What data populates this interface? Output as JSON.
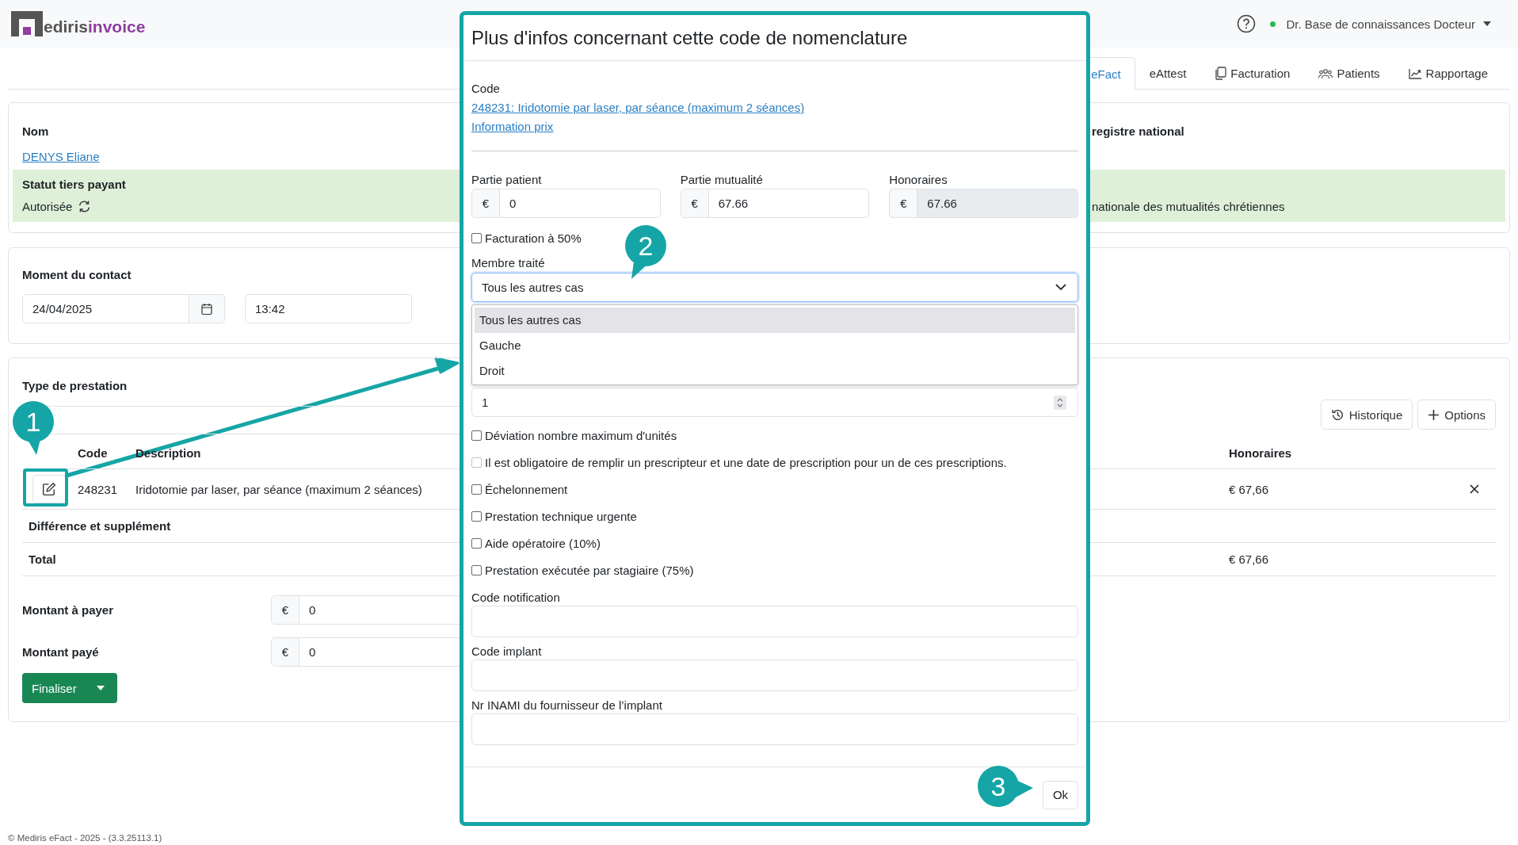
{
  "header": {
    "logo_parts": [
      "ediris",
      "invoice"
    ],
    "online": true,
    "user": "Dr. Base de connaissances Docteur"
  },
  "tabs": [
    {
      "label": "eFact",
      "selected": true
    },
    {
      "label": "eAttest",
      "selected": false
    },
    {
      "label": "Facturation",
      "selected": false
    },
    {
      "label": "Patients",
      "selected": false
    },
    {
      "label": "Rapportage",
      "selected": false
    }
  ],
  "patient_card": {
    "name_label": "Nom",
    "name": "DENYS Eliane",
    "status_label": "Statut tiers payant",
    "status": "Autorisée",
    "column_2_label": "registre national",
    "column_2_value": "nationale des mutualités chrétiennes"
  },
  "contact": {
    "title": "Moment du contact",
    "date": "24/04/2025",
    "time": "13:42"
  },
  "services": {
    "title": "Type de prestation",
    "buttons": [
      "Historique",
      "Options"
    ],
    "columns": [
      "Code",
      "Description",
      "Honoraires"
    ],
    "rows": [
      {
        "code": "248231",
        "description": "Iridotomie par laser, par séance (maximum 2 séances)",
        "fee": "€ 67,66"
      }
    ],
    "difference_label": "Différence et supplément",
    "total_label": "Total",
    "total": "€ 67,66",
    "amounts": [
      {
        "label": "Montant à payer",
        "currency": "€",
        "value": "0"
      },
      {
        "label": "Montant payé",
        "currency": "€",
        "value": "0"
      }
    ],
    "finalize_button": "Finaliser"
  },
  "footer": "© Mediris eFact - 2025 - (3.3.25113.1)",
  "modal": {
    "title": "Plus d'infos concernant cette code de nomenclature",
    "code_label": "Code",
    "code_link": "248231: Iridotomie par laser, par séance (maximum 2 séances)",
    "price_link": "Information prix",
    "amounts": [
      {
        "label": "Partie patient",
        "currency": "€",
        "value": "0",
        "disabled": false
      },
      {
        "label": "Partie mutualité",
        "currency": "€",
        "value": "67.66",
        "disabled": false
      },
      {
        "label": "Honoraires",
        "currency": "€",
        "value": "67.66",
        "disabled": true
      }
    ],
    "half_billing": {
      "label": "Facturation à 50%",
      "checked": false
    },
    "member": {
      "label": "Membre traité",
      "value": "Tous les autres cas",
      "expanded": true,
      "options": [
        {
          "label": "Tous les autres cas",
          "selected": true
        },
        {
          "label": "Gauche",
          "selected": false
        },
        {
          "label": "Droit",
          "selected": false
        }
      ]
    },
    "units": "1",
    "checkboxes": [
      {
        "label": "Déviation nombre maximum d'unités",
        "checked": false,
        "disabled": false
      },
      {
        "label": "Il est obligatoire de remplir un prescripteur et une date de prescription pour un de ces prescriptions.",
        "checked": false,
        "disabled": true
      },
      {
        "label": "Échelonnement",
        "checked": false,
        "disabled": false
      },
      {
        "label": "Prestation technique urgente",
        "checked": false,
        "disabled": false
      },
      {
        "label": "Aide opératoire (10%)",
        "checked": false,
        "disabled": false
      },
      {
        "label": "Prestation exécutée par stagiaire (75%)",
        "checked": false,
        "disabled": false
      }
    ],
    "text_fields": [
      {
        "label": "Code notification"
      },
      {
        "label": "Code implant"
      },
      {
        "label": "Nr INAMI du fournisseur de l’implant"
      }
    ],
    "ok_button": "Ok"
  },
  "annotations": [
    {
      "number": "1"
    },
    {
      "number": "2"
    },
    {
      "number": "3"
    }
  ]
}
